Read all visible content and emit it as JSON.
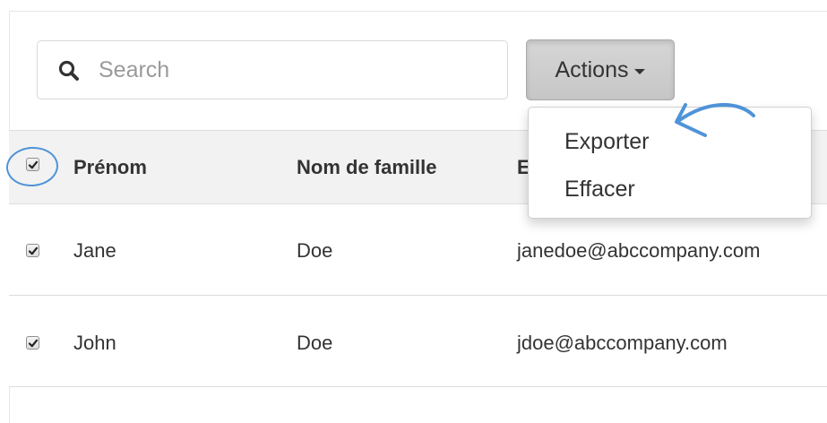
{
  "search": {
    "placeholder": "Search",
    "value": "",
    "icon": "search-icon"
  },
  "toolbar": {
    "actions_label": "Actions"
  },
  "dropdown": {
    "items": [
      {
        "label": "Exporter"
      },
      {
        "label": "Effacer"
      }
    ]
  },
  "table": {
    "columns": [
      "Prénom",
      "Nom de famille",
      "E"
    ],
    "header_checked": true,
    "rows": [
      {
        "checked": true,
        "first_name": "Jane",
        "last_name": "Doe",
        "email": "janedoe@abccompany.com"
      },
      {
        "checked": true,
        "first_name": "John",
        "last_name": "Doe",
        "email": "jdoe@abccompany.com"
      }
    ]
  },
  "colors": {
    "annotation_blue": "#4f93d8",
    "header_bg": "#f2f2f2",
    "button_bg": "#cccccc"
  }
}
